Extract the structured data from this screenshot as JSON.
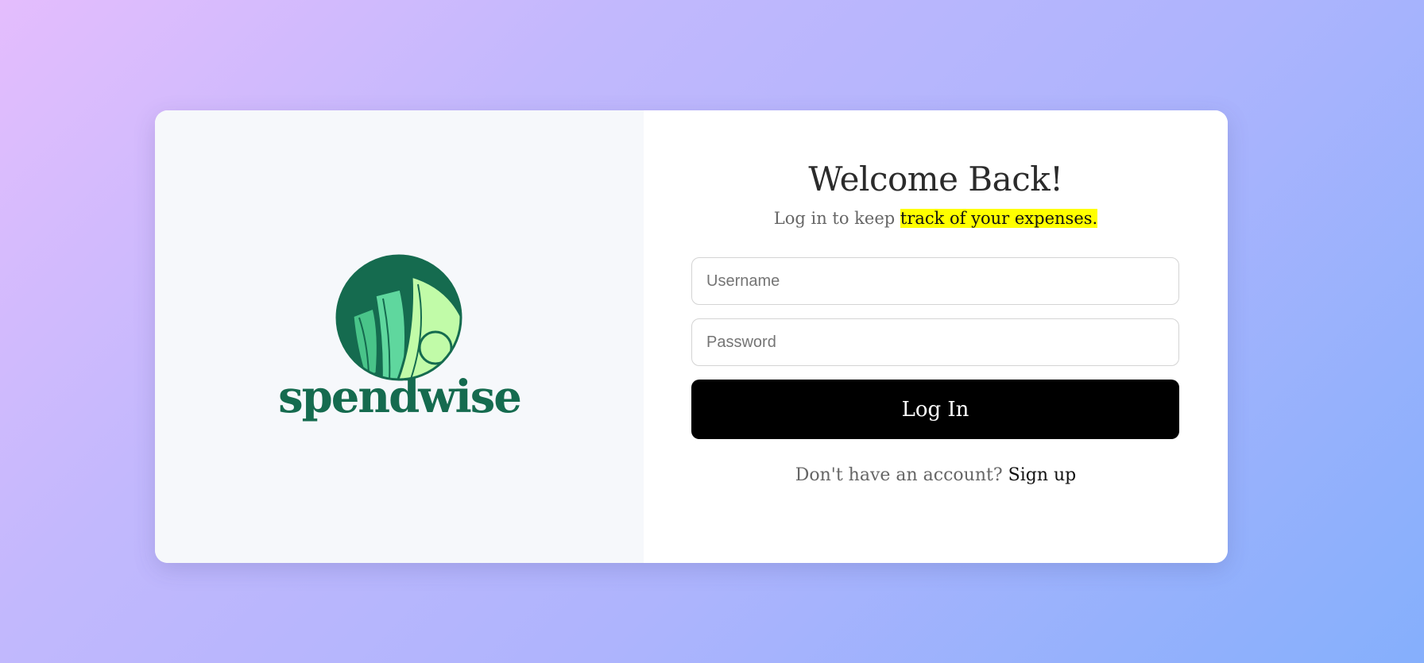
{
  "brand": {
    "name": "spendwise",
    "logo_icon": "money-bills-icon",
    "colors": {
      "primary": "#156b4f",
      "bill_dark": "#49c489",
      "bill_mid": "#5fd79e",
      "bill_light": "#c1fba8"
    }
  },
  "login": {
    "title": "Welcome Back!",
    "subtitle_prefix": "Log in to keep ",
    "subtitle_highlight": "track of your expenses.",
    "username_placeholder": "Username",
    "password_placeholder": "Password",
    "button_label": "Log In",
    "signup_prompt": "Don't have an account? ",
    "signup_link": "Sign up"
  },
  "colors": {
    "highlight": "#ffff00",
    "button_bg": "#000000",
    "gradient_start": "#e4bdfd",
    "gradient_end": "#85affc"
  }
}
